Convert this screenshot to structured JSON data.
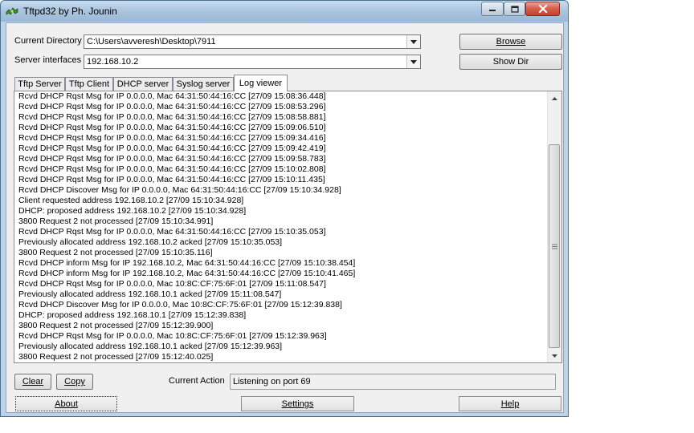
{
  "window": {
    "title": "Tftpd32 by Ph. Jounin",
    "controls": {
      "minimize": "minimize-icon",
      "maximize": "maximize-icon",
      "close": "close-icon"
    }
  },
  "config": {
    "current_directory_label": "Current Directory",
    "current_directory_value": "C:\\Users\\avveresh\\Desktop\\7911",
    "server_interfaces_label": "Server interfaces",
    "server_interfaces_value": "192.168.10.2",
    "browse_label": "Browse",
    "show_dir_label": "Show Dir"
  },
  "tabs": [
    {
      "label": "Tftp Server",
      "active": false
    },
    {
      "label": "Tftp Client",
      "active": false
    },
    {
      "label": "DHCP server",
      "active": false
    },
    {
      "label": "Syslog server",
      "active": false
    },
    {
      "label": "Log viewer",
      "active": true
    }
  ],
  "log": {
    "lines": [
      "Rcvd DHCP Rqst Msg for IP 0.0.0.0, Mac 64:31:50:44:16:CC [27/09 15:08:36.448]",
      "Rcvd DHCP Rqst Msg for IP 0.0.0.0, Mac 64:31:50:44:16:CC [27/09 15:08:53.296]",
      "Rcvd DHCP Rqst Msg for IP 0.0.0.0, Mac 64:31:50:44:16:CC [27/09 15:08:58.881]",
      "Rcvd DHCP Rqst Msg for IP 0.0.0.0, Mac 64:31:50:44:16:CC [27/09 15:09:06.510]",
      "Rcvd DHCP Rqst Msg for IP 0.0.0.0, Mac 64:31:50:44:16:CC [27/09 15:09:34.416]",
      "Rcvd DHCP Rqst Msg for IP 0.0.0.0, Mac 64:31:50:44:16:CC [27/09 15:09:42.419]",
      "Rcvd DHCP Rqst Msg for IP 0.0.0.0, Mac 64:31:50:44:16:CC [27/09 15:09:58.783]",
      "Rcvd DHCP Rqst Msg for IP 0.0.0.0, Mac 64:31:50:44:16:CC [27/09 15:10:02.808]",
      "Rcvd DHCP Rqst Msg for IP 0.0.0.0, Mac 64:31:50:44:16:CC [27/09 15:10:11.435]",
      "Rcvd DHCP Discover Msg for IP 0.0.0.0, Mac 64:31:50:44:16:CC [27/09 15:10:34.928]",
      "Client requested address 192.168.10.2 [27/09 15:10:34.928]",
      "DHCP: proposed address 192.168.10.2 [27/09 15:10:34.928]",
      "3800 Request 2 not processed [27/09 15:10:34.991]",
      "Rcvd DHCP Rqst Msg for IP 0.0.0.0, Mac 64:31:50:44:16:CC [27/09 15:10:35.053]",
      "Previously allocated address 192.168.10.2 acked [27/09 15:10:35.053]",
      "3800 Request 2 not processed [27/09 15:10:35.116]",
      "Rcvd DHCP inform Msg for IP 192.168.10.2, Mac 64:31:50:44:16:CC [27/09 15:10:38.454]",
      "Rcvd DHCP inform Msg for IP 192.168.10.2, Mac 64:31:50:44:16:CC [27/09 15:10:41.465]",
      "Rcvd DHCP Rqst Msg for IP 0.0.0.0, Mac 10:8C:CF:75:6F:01 [27/09 15:11:08.547]",
      "Previously allocated address 192.168.10.1 acked [27/09 15:11:08.547]",
      "Rcvd DHCP Discover Msg for IP 0.0.0.0, Mac 10:8C:CF:75:6F:01 [27/09 15:12:39.838]",
      "DHCP: proposed address 192.168.10.1 [27/09 15:12:39.838]",
      "3800 Request 2 not processed [27/09 15:12:39.900]",
      "Rcvd DHCP Rqst Msg for IP 0.0.0.0, Mac 10:8C:CF:75:6F:01 [27/09 15:12:39.963]",
      "Previously allocated address 192.168.10.1 acked [27/09 15:12:39.963]",
      "3800 Request 2 not processed [27/09 15:12:40.025]"
    ]
  },
  "actions": {
    "clear_label": "Clear",
    "copy_label": "Copy",
    "current_action_label": "Current Action",
    "current_action_value": "Listening on port 69"
  },
  "footer": {
    "about_label": "About",
    "settings_label": "Settings",
    "help_label": "Help"
  }
}
